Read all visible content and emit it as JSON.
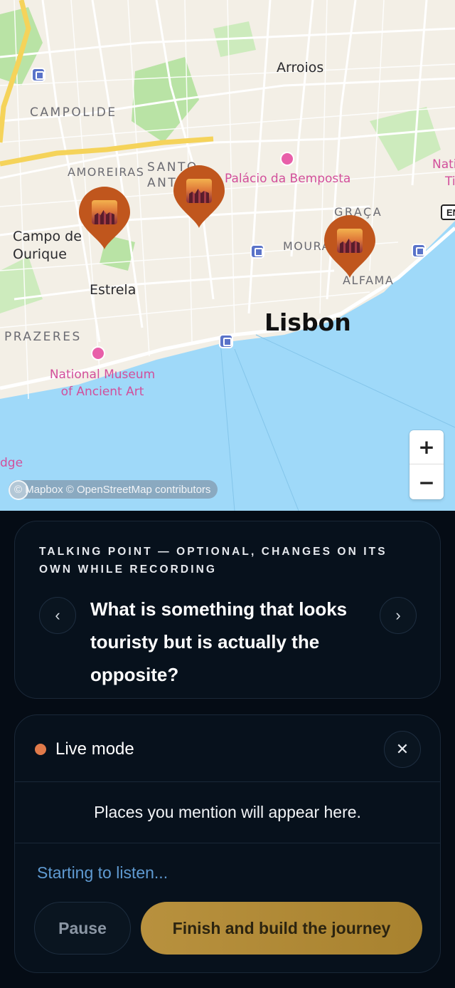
{
  "map": {
    "districts": [
      "CAMPOLIDE",
      "AMOREIRAS",
      "SANTO ANT",
      "GRAÇA",
      "MOURA",
      "ALFAMA",
      "PRAZERES"
    ],
    "areas": [
      "Arroios",
      "Campo de Ourique",
      "Estrela"
    ],
    "city": "Lisbon",
    "pois": [
      "Palácio da Bemposta",
      "National Museum of Ancient Art"
    ],
    "edge_labels": [
      "Nati",
      "Ti",
      "dge",
      "EN"
    ],
    "pin_icon": "sunset-city-thumbnail",
    "zoom_in_label": "+",
    "zoom_out_label": "−",
    "attribution": "© Mapbox © OpenStreetMap contributors",
    "colors": {
      "water": "#9fd9f9",
      "park": "#b9e3a5",
      "pin": "#c0561d"
    }
  },
  "talking_point": {
    "eyebrow": "TALKING POINT — OPTIONAL, CHANGES ON ITS OWN WHILE RECORDING",
    "question": "What is something that looks touristy but is actually the opposite?",
    "prev_icon": "‹",
    "next_icon": "›"
  },
  "live": {
    "title": "Live mode",
    "close_icon": "✕",
    "places_placeholder": "Places you mention will appear here.",
    "status": "Starting to listen...",
    "pause_label": "Pause",
    "finish_label": "Finish and build the journey",
    "colors": {
      "dot": "#e07a4a",
      "status": "#5f9ad1",
      "finish": "#b8913e"
    }
  }
}
